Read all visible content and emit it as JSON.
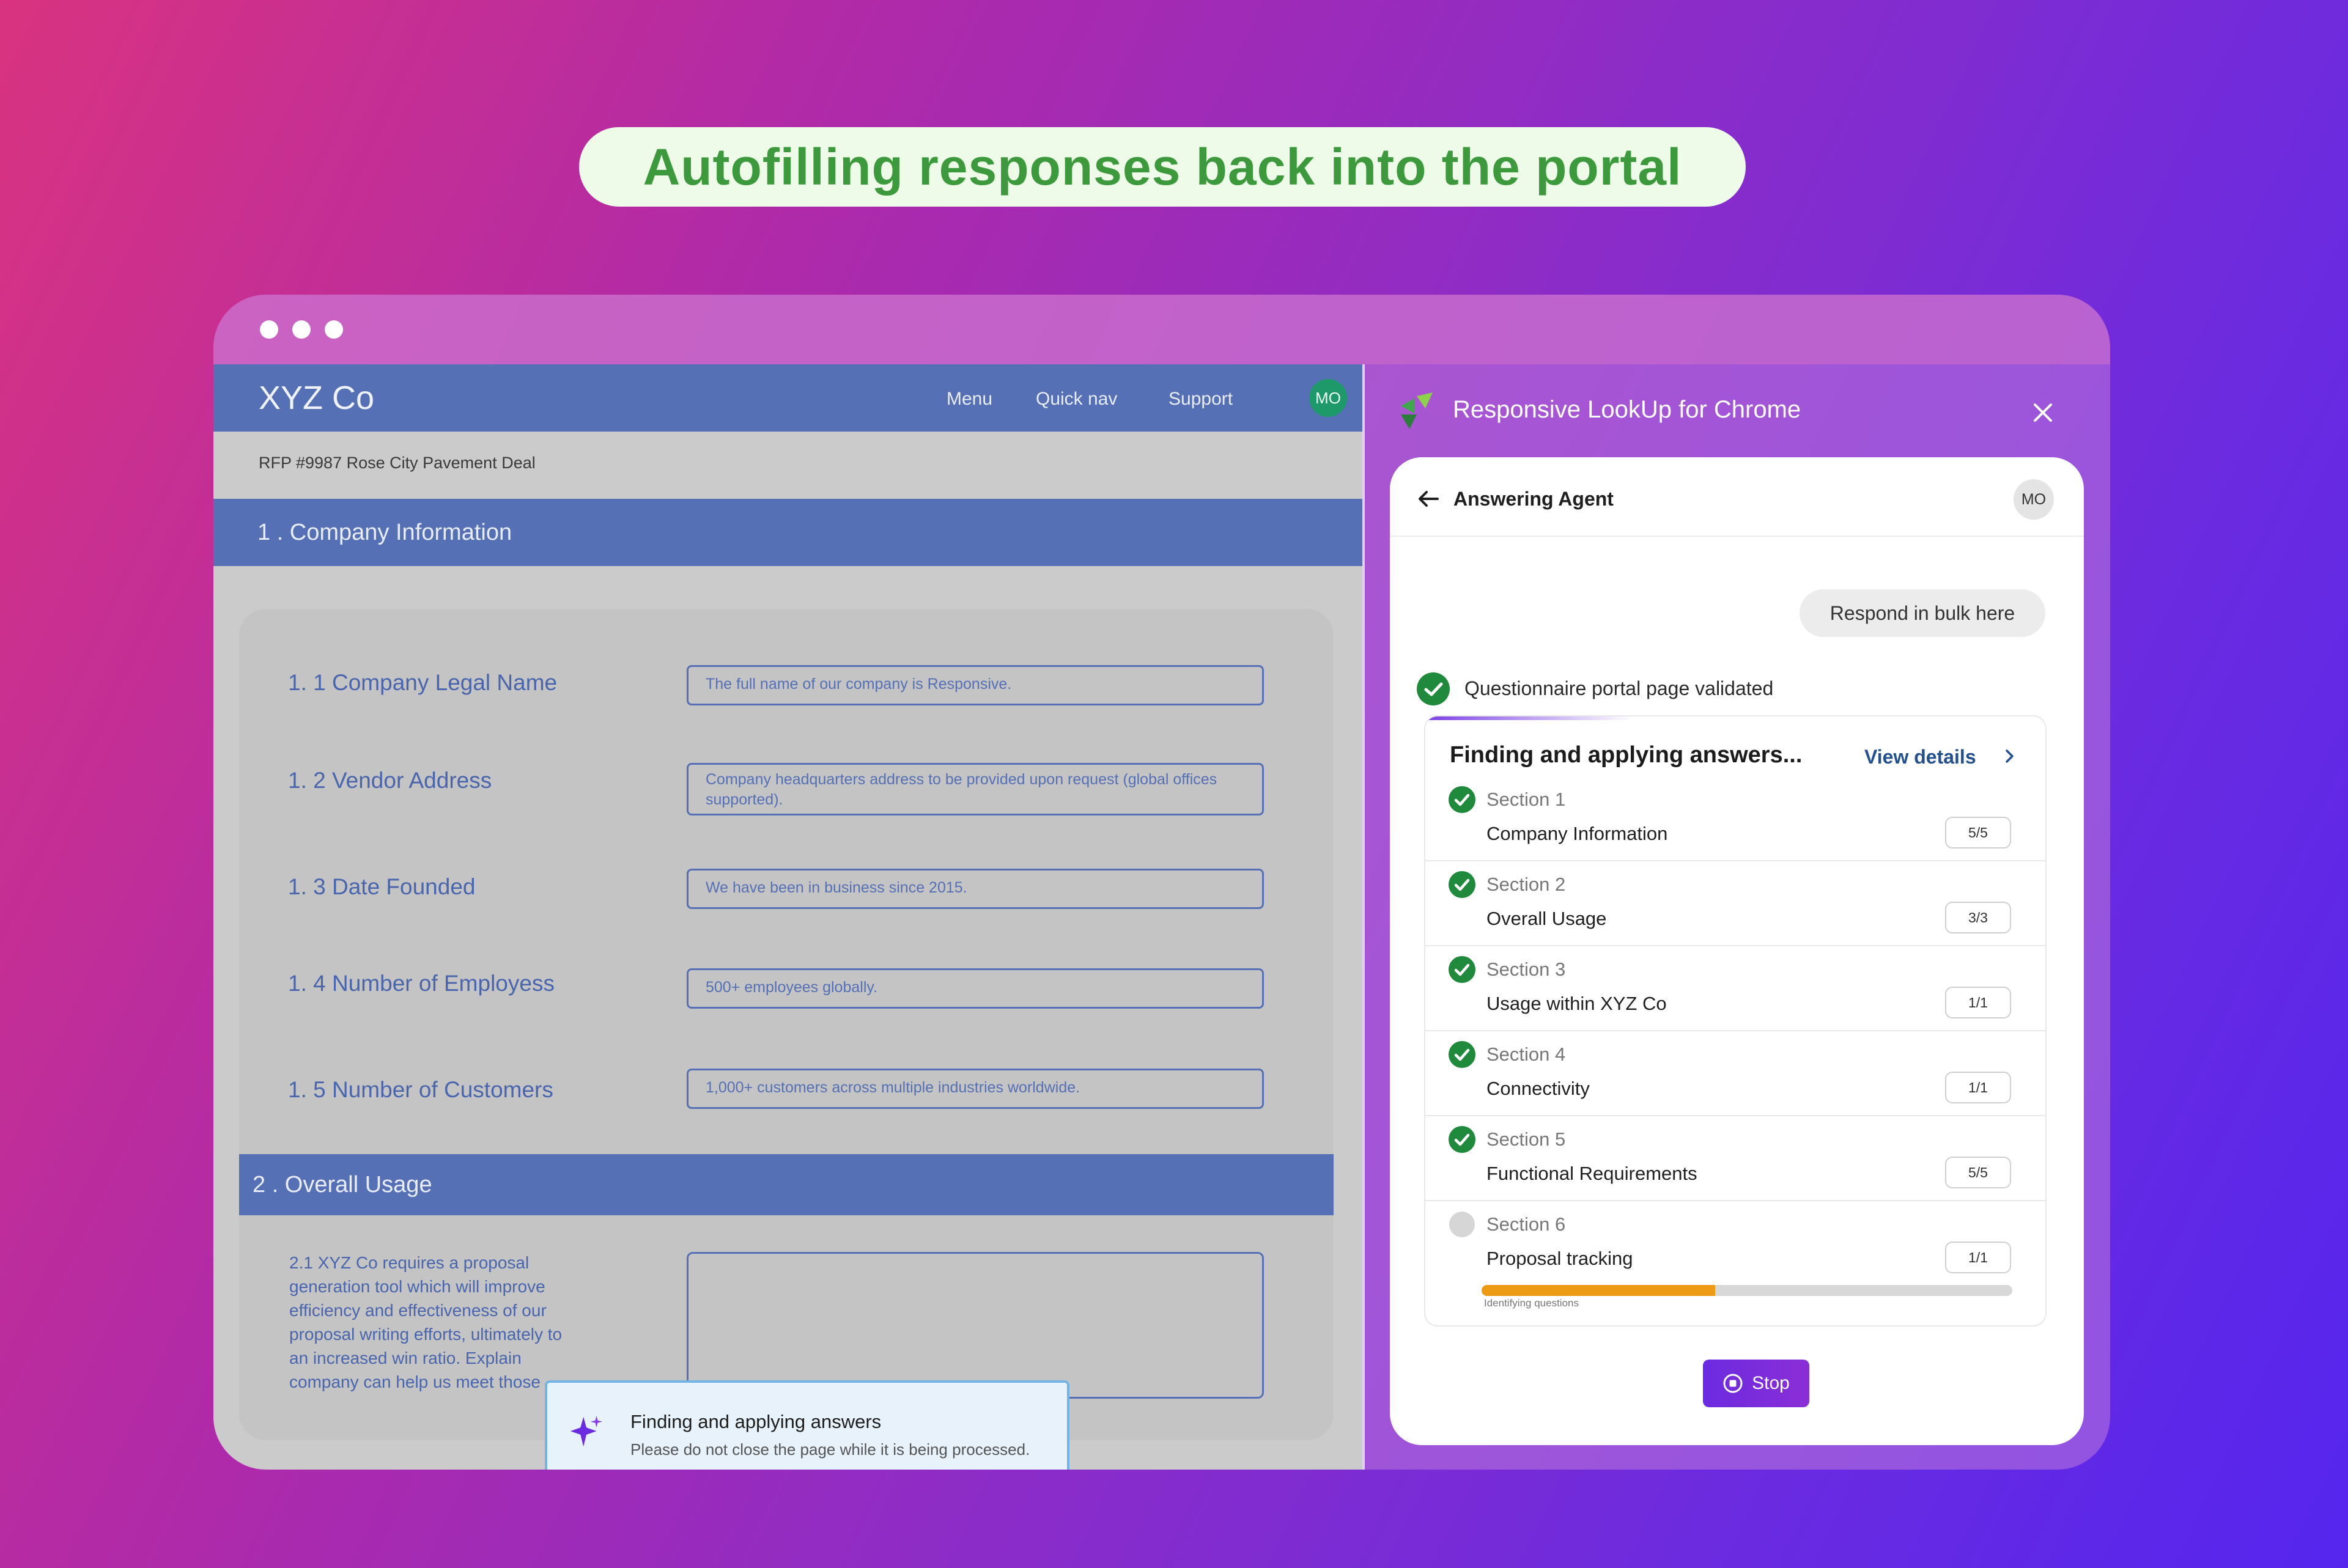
{
  "headline": "Autofilling responses back into the portal",
  "portal": {
    "brand": "XYZ Co",
    "nav": [
      "Menu",
      "Quick nav",
      "Support"
    ],
    "avatar": "MO",
    "breadcrumb": "RFP #9987 Rose City Pavement Deal",
    "section1_title": "1 . Company Information",
    "questions": [
      {
        "label": "1. 1 Company Legal Name",
        "answer": "The full name of our company is Responsive."
      },
      {
        "label": "1. 2 Vendor Address",
        "answer": "Company headquarters address to be provided upon request (global offices supported)."
      },
      {
        "label": "1. 3 Date Founded",
        "answer": "We have been in business since 2015."
      },
      {
        "label": "1. 4 Number of Employess",
        "answer": "500+ employees globally."
      },
      {
        "label": "1. 5 Number of Customers",
        "answer": "1,000+ customers across multiple industries worldwide."
      }
    ],
    "section2_title": "2 . Overall Usage",
    "q21": "2.1 XYZ Co requires a proposal generation tool which will improve efficiency and effectiveness of our proposal writing efforts, ultimately to an increased win ratio. Explain company can help us meet those"
  },
  "toast": {
    "title": "Finding and applying answers",
    "subtitle": "Please do not close the page while it is being processed.",
    "icon": "sparkle-icon"
  },
  "extension": {
    "title": "Responsive LookUp for Chrome",
    "panel_title": "Answering Agent",
    "avatar": "MO",
    "bulk_button": "Respond in bulk here",
    "validated": "Questionnaire portal page validated",
    "progress_title": "Finding and applying answers...",
    "view_details": "View details",
    "sections": [
      {
        "num": "Section 1",
        "name": "Company Information",
        "badge": "5/5",
        "done": true
      },
      {
        "num": "Section 2",
        "name": "Overall Usage",
        "badge": "3/3",
        "done": true
      },
      {
        "num": "Section 3",
        "name": "Usage within XYZ Co",
        "badge": "1/1",
        "done": true
      },
      {
        "num": "Section 4",
        "name": "Connectivity",
        "badge": "1/1",
        "done": true
      },
      {
        "num": "Section 5",
        "name": "Functional Requirements",
        "badge": "5/5",
        "done": true
      },
      {
        "num": "Section 6",
        "name": "Proposal tracking",
        "badge": "1/1",
        "done": false
      }
    ],
    "progress_fraction": 0.44,
    "progress_caption": "Identifying questions",
    "stop_label": "Stop",
    "colors": {
      "success": "#1f8a3c",
      "pending": "#d6d6d6",
      "progress": "#ed9b14",
      "accent": "#6b2be0"
    }
  }
}
